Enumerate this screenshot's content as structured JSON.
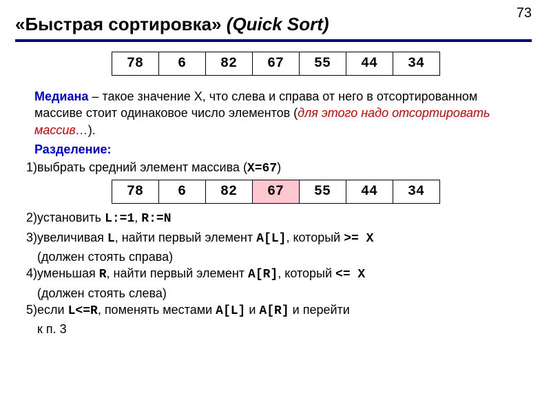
{
  "pageNumber": "73",
  "title": {
    "main": "«Быстрая сортировка» ",
    "italic": "(Quick Sort)"
  },
  "array1": [
    "78",
    "6",
    "82",
    "67",
    "55",
    "44",
    "34"
  ],
  "median": {
    "term": "Медиана",
    "text": " – такое значение X, что слева и справа от него в отсортированном массиве стоит одинаковое число элементов (",
    "ital": "для этого надо отсортировать массив…",
    "close": ")."
  },
  "sectionLabel": "Разделение:",
  "step1": {
    "num": "1)",
    "text": "выбрать средний элемент массива (",
    "code": "X=67",
    "close": ")"
  },
  "array2": {
    "cells": [
      "78",
      "6",
      "82",
      "67",
      "55",
      "44",
      "34"
    ],
    "highlightIndex": 3
  },
  "step2": {
    "num": "2)",
    "pre": "установить ",
    "c1": "L:=1",
    "mid": ", ",
    "c2": "R:=N"
  },
  "step3": {
    "num": "3)",
    "pre": "увеличивая ",
    "c1": "L",
    "mid1": ", найти первый элемент ",
    "c2": "A[L]",
    "mid2": ", который ",
    "c3": ">= X",
    "cont": "(должен стоять справа)"
  },
  "step4": {
    "num": "4)",
    "pre": "уменьшая ",
    "c1": "R",
    "mid1": ", найти первый элемент ",
    "c2": "A[R]",
    "mid2": ", который ",
    "c3": "<= X",
    "cont": "(должен стоять слева)"
  },
  "step5": {
    "num": "5)",
    "pre": "если ",
    "c1": "L<=R",
    "mid1": ", поменять местами ",
    "c2": "A[L]",
    "mid2": " и ",
    "c3": "A[R]",
    "mid3": " и перейти",
    "cont": "к п. 3"
  }
}
